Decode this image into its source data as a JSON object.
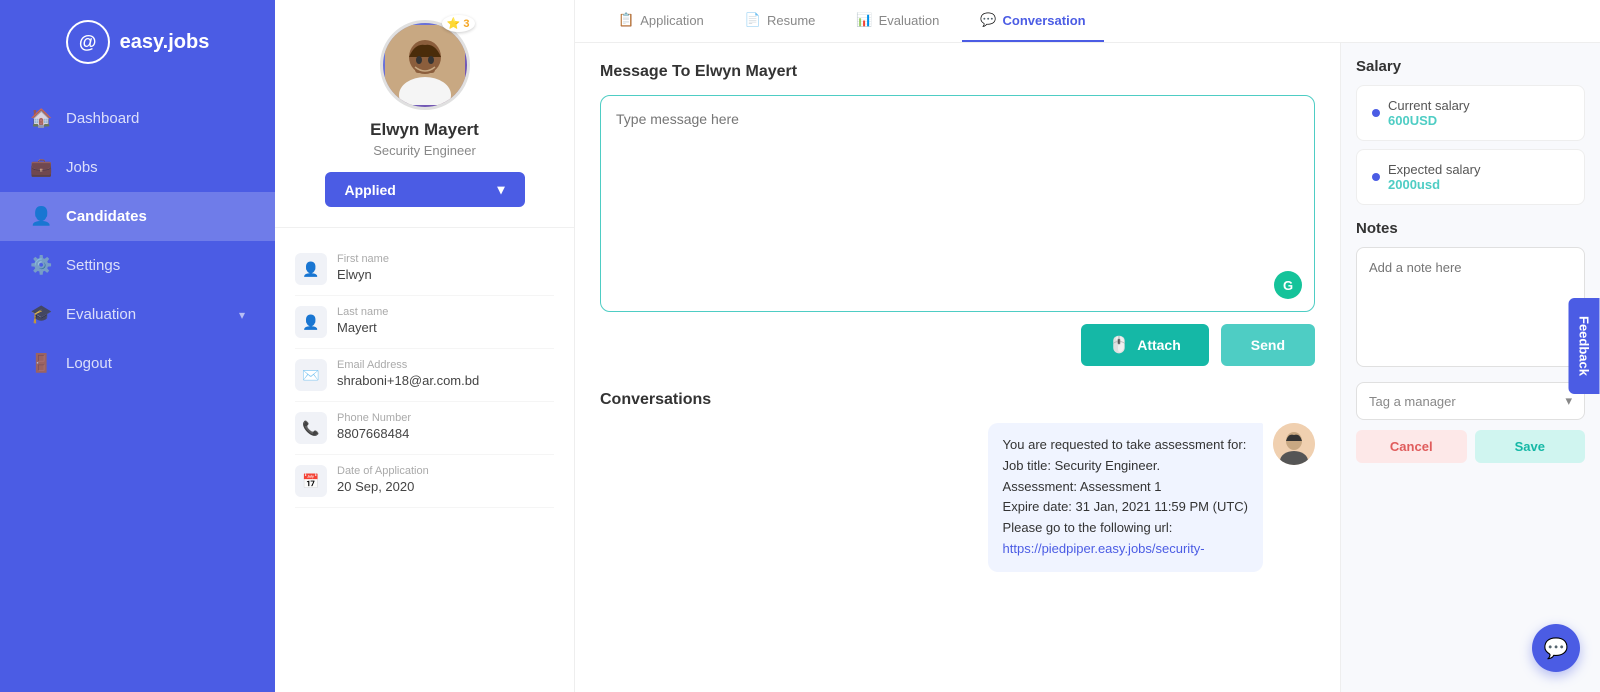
{
  "sidebar": {
    "logo_text": "easy.jobs",
    "items": [
      {
        "label": "Dashboard",
        "icon": "🏠",
        "active": false
      },
      {
        "label": "Jobs",
        "icon": "💼",
        "active": false
      },
      {
        "label": "Candidates",
        "icon": "👤",
        "active": true
      },
      {
        "label": "Settings",
        "icon": "⚙️",
        "active": false
      },
      {
        "label": "Evaluation",
        "icon": "🎓",
        "active": false
      },
      {
        "label": "Logout",
        "icon": "🚪",
        "active": false
      }
    ]
  },
  "profile": {
    "name": "Elwyn Mayert",
    "title": "Security Engineer",
    "status": "Applied",
    "star_count": "3",
    "fields": [
      {
        "label": "First name",
        "value": "Elwyn",
        "icon": "👤"
      },
      {
        "label": "Last name",
        "value": "Mayert",
        "icon": "👤"
      },
      {
        "label": "Email Address",
        "value": "shraboni+18@ar.com.bd",
        "icon": "✉️"
      },
      {
        "label": "Phone Number",
        "value": "8807668484",
        "icon": "📞"
      },
      {
        "label": "Date of Application",
        "value": "20 Sep, 2020",
        "icon": "📅"
      }
    ]
  },
  "tabs": [
    {
      "label": "Application",
      "icon": "📋",
      "active": false
    },
    {
      "label": "Resume",
      "icon": "📄",
      "active": false
    },
    {
      "label": "Evaluation",
      "icon": "📊",
      "active": false
    },
    {
      "label": "Conversation",
      "icon": "💬",
      "active": true
    }
  ],
  "message": {
    "title": "Message To Elwyn Mayert",
    "placeholder": "Type message here",
    "attach_label": "Attach",
    "send_label": "Send"
  },
  "conversations": {
    "title": "Conversations",
    "bubble": {
      "text": "You are requested to take assessment for:\nJob title: Security Engineer.\nAssessment: Assessment 1\nExpire date: 31 Jan, 2021 11:59 PM (UTC)\nPlease go to the following url:\nhttps://piedpiper.easy.jobs/security-"
    }
  },
  "salary": {
    "title": "Salary",
    "current_label": "Current salary",
    "current_value": "600USD",
    "expected_label": "Expected salary",
    "expected_value": "2000usd"
  },
  "notes": {
    "title": "Notes",
    "placeholder": "Add a note here",
    "tag_label": "Tag a manager",
    "cancel_label": "Cancel",
    "save_label": "Save"
  },
  "feedback": {
    "label": "Feedback"
  }
}
